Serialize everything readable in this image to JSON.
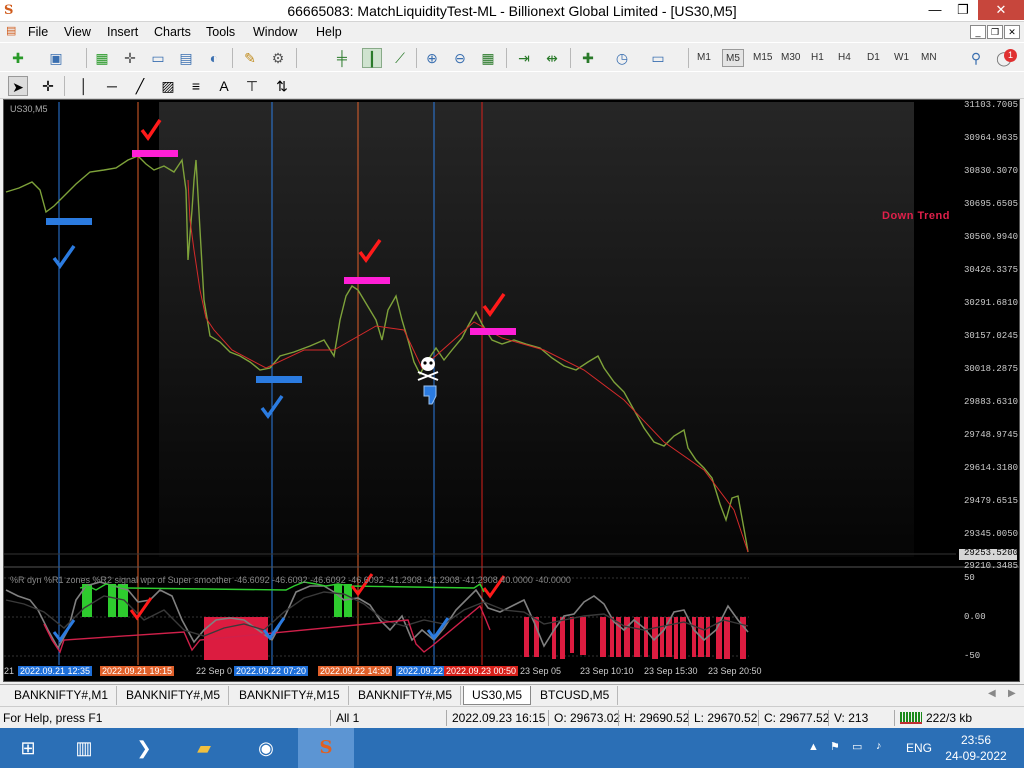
{
  "window": {
    "title": "66665083: MatchLiquidityTest-ML - Billionext Global Limited - [US30,M5]",
    "minimize": "—",
    "maximize": "❐",
    "close": "✕"
  },
  "menu": {
    "items": [
      "File",
      "View",
      "Insert",
      "Charts",
      "Tools",
      "Window",
      "Help"
    ],
    "mdi_minimize": "_",
    "mdi_restore": "❐",
    "mdi_close": "✕"
  },
  "toolbar": {
    "timeframes": [
      "M1",
      "M5",
      "M15",
      "M30",
      "H1",
      "H4",
      "D1",
      "W1",
      "MN"
    ],
    "active_timeframe": "M5",
    "notification_count": "1",
    "draw_tool_text": "A"
  },
  "chart": {
    "symbol_label": "US30,M5",
    "trend_label": "Down Trend",
    "price_axis": [
      "31103.7005",
      "30964.9635",
      "30830.3070",
      "30695.6505",
      "30560.9940",
      "30426.3375",
      "30291.6810",
      "30157.0245",
      "30018.2875",
      "29883.6310",
      "29748.9745",
      "29614.3180",
      "29479.6515",
      "29345.0050",
      "29210.3485"
    ],
    "current_price": "29253.5200",
    "indicator_header": "%R dyn  %R1 zones  %R2  signal wpr of Super smoother -46.6092  -46.6092  -46.6092  -46.6092  -41.2908  -41.2908  -41.2908  40.0000  -40.0000",
    "indicator_axis": [
      "50",
      "0.00",
      "-50"
    ],
    "time_axis_plain": [
      "21",
      "22 Sep 0",
      "23 Sep 05",
      "23 Sep 10:10",
      "23 Sep 15:30",
      "23 Sep 20:50"
    ],
    "time_markers": [
      {
        "label": "2022.09.21 12:35",
        "color": "#1e6fd9"
      },
      {
        "label": "2022.09.21 19:15",
        "color": "#e0602a"
      },
      {
        "label": "2022.09.22 07:20",
        "color": "#1e6fd9"
      },
      {
        "label": "2022.09.22 14:30",
        "color": "#e0602a"
      },
      {
        "label": "2022.09.22",
        "color": "#1e6fd9"
      },
      {
        "label": "2022.09.23 00:50",
        "color": "#d8201a"
      }
    ]
  },
  "tabs": {
    "items": [
      "BANKNIFTY#,M1",
      "BANKNIFTY#,M5",
      "BANKNIFTY#,M15",
      "BANKNIFTY#,M5",
      "US30,M5",
      "BTCUSD,M5"
    ],
    "active": "US30,M5"
  },
  "status": {
    "help": "For Help, press F1",
    "profile": "All 1",
    "datetime": "2022.09.23 16:15",
    "open": "O: 29673.02",
    "high": "H: 29690.52",
    "low": "L: 29670.52",
    "close": "C: 29677.52",
    "volume": "V: 213",
    "traffic": "222/3 kb"
  },
  "taskbar": {
    "language": "ENG",
    "time": "23:56",
    "date": "24-09-2022"
  },
  "colors": {
    "blue_marker": "#1e6fd9",
    "orange_marker": "#e0602a",
    "magenta_zone": "#ff1fd6",
    "red_check": "#ff1a1a",
    "down_trend": "#e0204a",
    "green_bar": "#2ecc2e",
    "red_bar": "#dc1c40"
  }
}
